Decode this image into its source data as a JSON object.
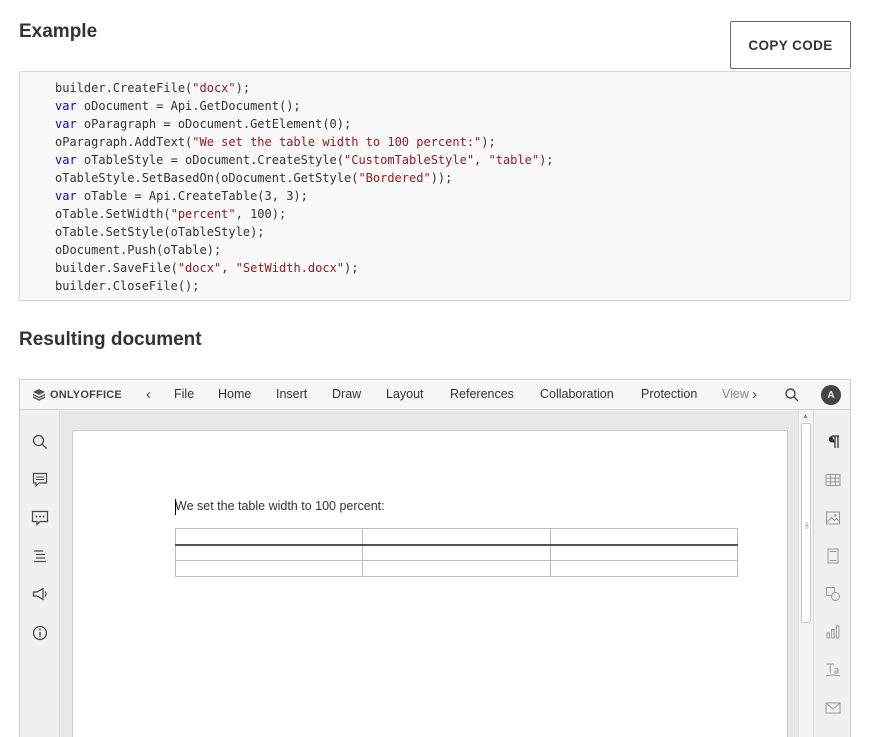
{
  "header": {
    "example_title": "Example",
    "copy_button": "COPY CODE",
    "result_title": "Resulting document"
  },
  "code": [
    [
      {
        "t": "builder.CreateFile("
      },
      {
        "t": "\"docx\"",
        "c": "str"
      },
      {
        "t": ");"
      }
    ],
    [
      {
        "t": "var",
        "c": "kw"
      },
      {
        "t": " oDocument = Api.GetDocument();"
      }
    ],
    [
      {
        "t": "var",
        "c": "kw"
      },
      {
        "t": " oParagraph = oDocument.GetElement(0);"
      }
    ],
    [
      {
        "t": "oParagraph.AddText("
      },
      {
        "t": "\"We set the table width to 100 percent:\"",
        "c": "str"
      },
      {
        "t": ");"
      }
    ],
    [
      {
        "t": "var",
        "c": "kw"
      },
      {
        "t": " oTableStyle = oDocument.CreateStyle("
      },
      {
        "t": "\"CustomTableStyle\"",
        "c": "str"
      },
      {
        "t": ", "
      },
      {
        "t": "\"table\"",
        "c": "str"
      },
      {
        "t": ");"
      }
    ],
    [
      {
        "t": "oTableStyle.SetBasedOn(oDocument.GetStyle("
      },
      {
        "t": "\"Bordered\"",
        "c": "str"
      },
      {
        "t": "));"
      }
    ],
    [
      {
        "t": "var",
        "c": "kw"
      },
      {
        "t": " oTable = Api.CreateTable(3, 3);"
      }
    ],
    [
      {
        "t": "oTable.SetWidth("
      },
      {
        "t": "\"percent\"",
        "c": "str"
      },
      {
        "t": ", 100);"
      }
    ],
    [
      {
        "t": "oTable.SetStyle(oTableStyle);"
      }
    ],
    [
      {
        "t": "oDocument.Push(oTable);"
      }
    ],
    [
      {
        "t": "builder.SaveFile("
      },
      {
        "t": "\"docx\"",
        "c": "str"
      },
      {
        "t": ", "
      },
      {
        "t": "\"SetWidth.docx\"",
        "c": "str"
      },
      {
        "t": ");"
      }
    ],
    [
      {
        "t": "builder.CloseFile();"
      }
    ]
  ],
  "editor": {
    "logo": "ONLYOFFICE",
    "menu": [
      "File",
      "Home",
      "Insert",
      "Draw",
      "Layout",
      "References",
      "Collaboration",
      "Protection",
      "View"
    ],
    "avatar": "A",
    "left_icons": [
      "search-icon",
      "comments-icon",
      "chat-icon",
      "navigation-icon",
      "feedback-icon",
      "about-icon"
    ],
    "right_icons": [
      "paragraph-settings-icon",
      "table-settings-icon",
      "image-settings-icon",
      "header-footer-icon",
      "shape-settings-icon",
      "chart-settings-icon",
      "textart-icon",
      "mail-merge-icon"
    ],
    "doc_text": "We set the table width to 100 percent:",
    "table_rows": 3,
    "table_cols": 3
  },
  "colors": {
    "keyword": "#0000ff",
    "string": "#a31515",
    "accent": "#444444"
  }
}
